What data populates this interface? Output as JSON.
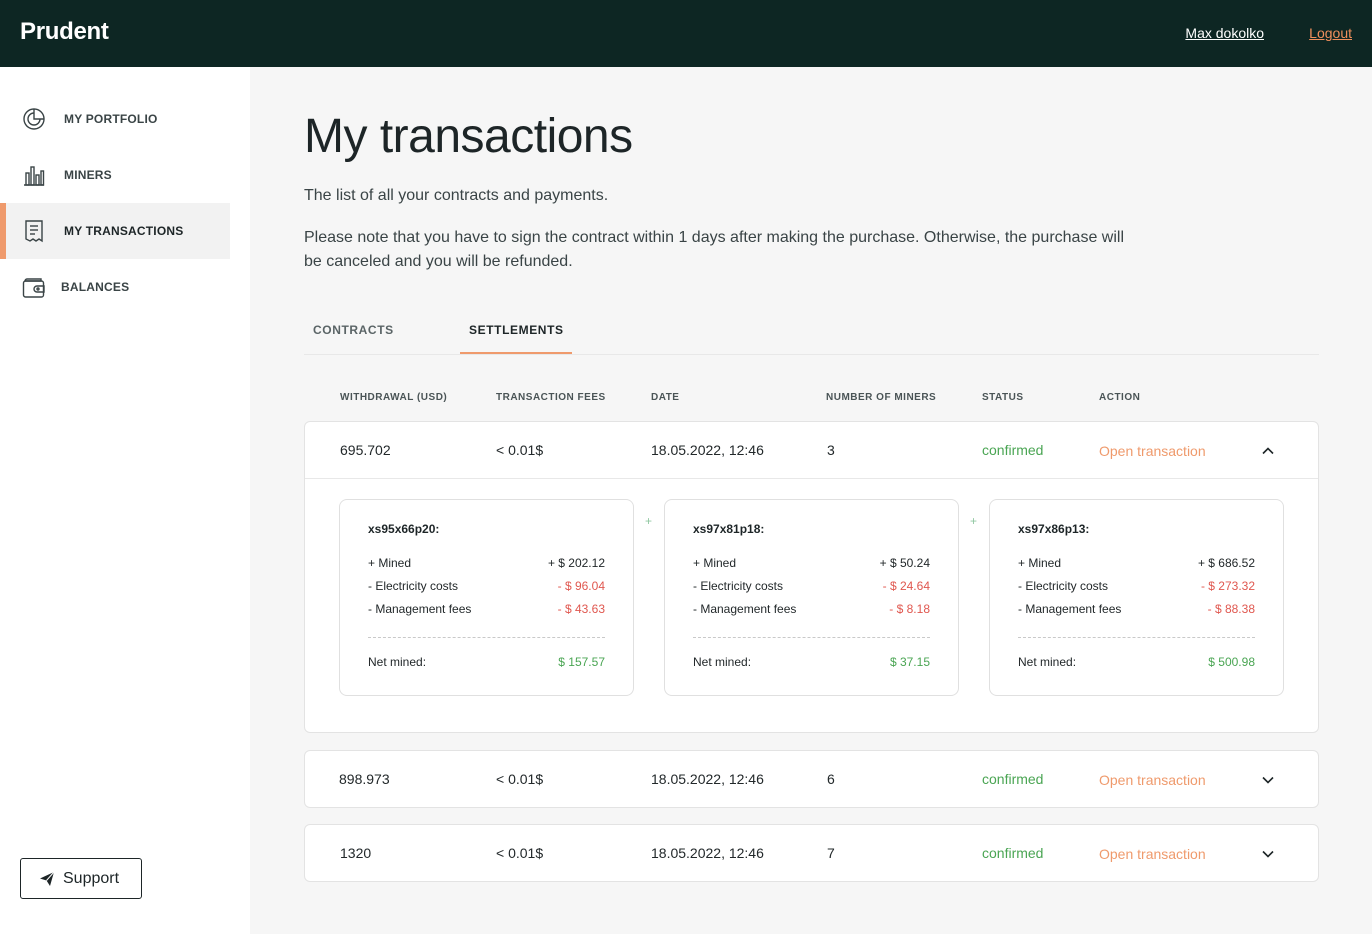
{
  "header": {
    "logo": "Prudent",
    "user": "Max dokolko",
    "logout": "Logout"
  },
  "sidebar": {
    "items": [
      {
        "label": "MY PORTFOLIO",
        "icon": "pie-chart-icon"
      },
      {
        "label": "MINERS",
        "icon": "bar-chart-icon"
      },
      {
        "label": "MY TRANSACTIONS",
        "icon": "receipt-icon"
      },
      {
        "label": "BALANCES",
        "icon": "wallet-icon"
      }
    ],
    "active_index": 2,
    "support_label": "Support"
  },
  "page": {
    "title": "My transactions",
    "subtitle": "The list of all your contracts and payments.",
    "note": "Please note that you have to sign the contract within 1 days after making the purchase. Otherwise, the purchase will be canceled and you will be refunded."
  },
  "tabs": [
    {
      "label": "CONTRACTS"
    },
    {
      "label": "SETTLEMENTS"
    }
  ],
  "active_tab": 1,
  "table": {
    "columns": [
      "WITHDRAWAL (USD)",
      "TRANSACTION FEES",
      "DATE",
      "NUMBER OF MINERS",
      "STATUS",
      "ACTION"
    ],
    "rows": [
      {
        "withdrawal": "695.702",
        "fees": "< 0.01$",
        "date": "18.05.2022, 12:46",
        "miners": "3",
        "status": "confirmed",
        "action": "Open transaction",
        "expanded": true
      },
      {
        "withdrawal": "898.973",
        "fees": "< 0.01$",
        "date": "18.05.2022, 12:46",
        "miners": "6",
        "status": "confirmed",
        "action": "Open transaction",
        "expanded": false
      },
      {
        "withdrawal": "1320",
        "fees": "< 0.01$",
        "date": "18.05.2022, 12:46",
        "miners": "7",
        "status": "confirmed",
        "action": "Open transaction",
        "expanded": false
      }
    ]
  },
  "details": {
    "separator": "+",
    "labels": {
      "mined": "+ Mined",
      "electricity": "- Electricity costs",
      "management": "- Management fees",
      "net": "Net mined:"
    },
    "miners": [
      {
        "id": "xs95x66p20:",
        "mined": "+ $ 202.12",
        "electricity": "- $ 96.04",
        "management": "- $ 43.63",
        "net": "$ 157.57"
      },
      {
        "id": "xs97x81p18:",
        "mined": "+ $ 50.24",
        "electricity": "- $ 24.64",
        "management": "- $ 8.18",
        "net": "$ 37.15"
      },
      {
        "id": "xs97x86p13:",
        "mined": "+ $ 686.52",
        "electricity": "- $ 273.32",
        "management": "- $ 88.38",
        "net": "$ 500.98"
      }
    ]
  },
  "colors": {
    "header_bg": "#0d2623",
    "accent": "#ef9a6c",
    "positive": "#4aa553",
    "negative": "#e0574f"
  }
}
